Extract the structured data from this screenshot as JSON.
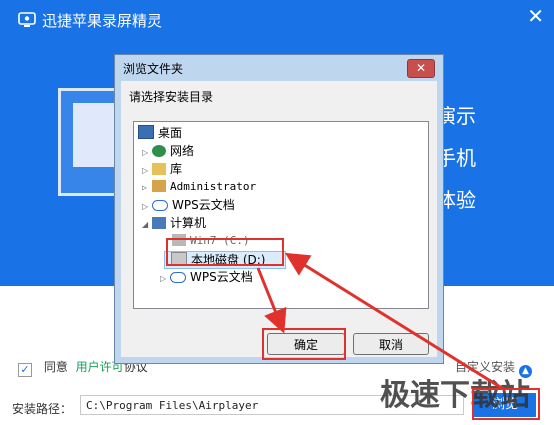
{
  "installer": {
    "title": "迅捷苹果录屏精灵",
    "close_glyph": "✕",
    "hero_lines": [
      "演示",
      "手机",
      "体验"
    ],
    "agree_label": "同意",
    "license_link": "用户许可",
    "license_tail": "协议",
    "custom_install": "自定义安装",
    "path_label": "安装路径：",
    "path_value": "C:\\Program Files\\Airplayer",
    "browse_label": "浏览",
    "watermark": "极速下载站",
    "brand_color": "#1a73e6"
  },
  "dialog": {
    "title": "浏览文件夹",
    "close_glyph": "✕",
    "prompt": "请选择安装目录",
    "tree": [
      {
        "label": "桌面",
        "icon": "desktop-icon"
      },
      {
        "label": "网络",
        "icon": "network-icon"
      },
      {
        "label": "库",
        "icon": "library-icon"
      },
      {
        "label": "Administrator",
        "icon": "user-icon"
      },
      {
        "label": "WPS云文档",
        "icon": "cloud-icon"
      },
      {
        "label": "计算机",
        "icon": "computer-icon"
      },
      {
        "label": "Win7 (C:)",
        "icon": "drive-c-icon"
      },
      {
        "label": "本地磁盘 (D:)",
        "icon": "drive-icon",
        "selected": true
      },
      {
        "label": "WPS云文档",
        "icon": "cloud-icon"
      }
    ],
    "ok_label": "确定",
    "cancel_label": "取消"
  },
  "colors": {
    "highlight": "#e0322c"
  }
}
